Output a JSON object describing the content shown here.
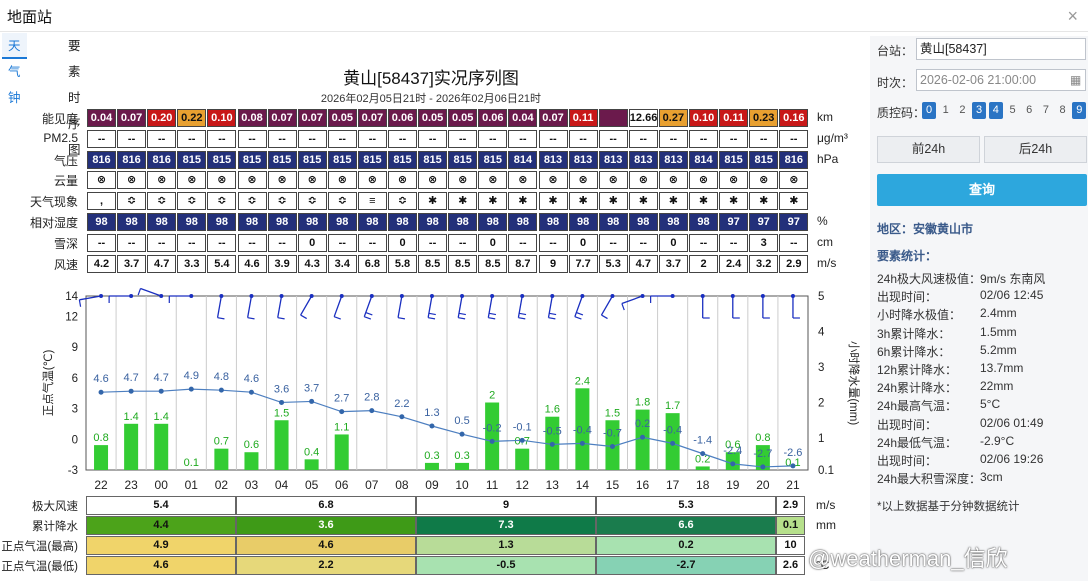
{
  "window": {
    "title": "地面站",
    "close": "×"
  },
  "tabs": [
    {
      "label": "天气钟",
      "active": true
    },
    {
      "label": "要素时序图",
      "active": false
    }
  ],
  "chart": {
    "title": "黄山[58437]实况序列图",
    "subtitle": "2026年02月05日21时 - 2026年02月06日21时"
  },
  "hours": [
    "22",
    "23",
    "00",
    "01",
    "02",
    "03",
    "04",
    "05",
    "06",
    "07",
    "08",
    "09",
    "10",
    "11",
    "12",
    "13",
    "14",
    "15",
    "16",
    "17",
    "18",
    "19",
    "20",
    "21"
  ],
  "rows": [
    {
      "label": "能见度",
      "unit": "km",
      "values": [
        "0.04",
        "0.07",
        "0.20",
        "0.22",
        "0.10",
        "0.08",
        "0.07",
        "0.07",
        "0.05",
        "0.07",
        "0.06",
        "0.05",
        "0.05",
        "0.06",
        "0.04",
        "0.07",
        "0.11",
        "",
        "12.66",
        "0.27",
        "0.10",
        "0.11",
        "0.23",
        "0.16"
      ],
      "colors": [
        "#6b1a4c",
        "#6b1a4c",
        "#c81818",
        "#e8a030",
        "#c81818",
        "#6b1a4c",
        "#6b1a4c",
        "#6b1a4c",
        "#6b1a4c",
        "#6b1a4c",
        "#6b1a4c",
        "#6b1a4c",
        "#6b1a4c",
        "#6b1a4c",
        "#6b1a4c",
        "#6b1a4c",
        "#c81818",
        "#6b1a4c",
        "#ffffff",
        "#e8a030",
        "#c81818",
        "#c81818",
        "#e8a030",
        "#c81818"
      ]
    },
    {
      "label": "PM2.5",
      "unit": "μg/m³",
      "values": [
        "--",
        "--",
        "--",
        "--",
        "--",
        "--",
        "--",
        "--",
        "--",
        "--",
        "--",
        "--",
        "--",
        "--",
        "--",
        "--",
        "--",
        "--",
        "--",
        "--",
        "--",
        "--",
        "--",
        "--"
      ]
    },
    {
      "label": "气压",
      "unit": "hPa",
      "values": [
        "816",
        "816",
        "816",
        "815",
        "815",
        "815",
        "815",
        "815",
        "815",
        "815",
        "815",
        "815",
        "815",
        "815",
        "814",
        "813",
        "813",
        "813",
        "813",
        "813",
        "814",
        "815",
        "815",
        "816"
      ],
      "bg": "#23307a"
    },
    {
      "label": "云量",
      "unit": "",
      "values": [
        "⊗",
        "⊗",
        "⊗",
        "⊗",
        "⊗",
        "⊗",
        "⊗",
        "⊗",
        "⊗",
        "⊗",
        "⊗",
        "⊗",
        "⊗",
        "⊗",
        "⊗",
        "⊗",
        "⊗",
        "⊗",
        "⊗",
        "⊗",
        "⊗",
        "⊗",
        "⊗",
        "⊗"
      ]
    },
    {
      "label": "天气现象",
      "unit": "",
      "values": [
        ",",
        "≎",
        "≎",
        "≎",
        "≎",
        "≎",
        "≎",
        "≎",
        "≎",
        "≡",
        "≎",
        "✱",
        "✱",
        "✱",
        "✱",
        "✱",
        "✱",
        "✱",
        "✱",
        "✱",
        "✱",
        "✱",
        "✱",
        "✱"
      ]
    },
    {
      "label": "相对湿度",
      "unit": "%",
      "values": [
        "98",
        "98",
        "98",
        "98",
        "98",
        "98",
        "98",
        "98",
        "98",
        "98",
        "98",
        "98",
        "98",
        "98",
        "98",
        "98",
        "98",
        "98",
        "98",
        "98",
        "98",
        "97",
        "97",
        "97"
      ],
      "bg": "#23307a"
    },
    {
      "label": "雪深",
      "unit": "cm",
      "values": [
        "--",
        "--",
        "--",
        "--",
        "--",
        "--",
        "--",
        "0",
        "--",
        "--",
        "0",
        "--",
        "--",
        "0",
        "--",
        "--",
        "0",
        "--",
        "--",
        "0",
        "--",
        "--",
        "3",
        "--"
      ]
    },
    {
      "label": "风速",
      "unit": "m/s",
      "values": [
        "4.2",
        "3.7",
        "4.7",
        "3.3",
        "5.4",
        "4.6",
        "3.9",
        "4.3",
        "3.4",
        "6.8",
        "5.8",
        "8.5",
        "8.5",
        "8.5",
        "8.7",
        "9",
        "7.7",
        "5.3",
        "4.7",
        "3.7",
        "2",
        "2.4",
        "3.2",
        "2.9"
      ]
    }
  ],
  "chart_data": {
    "type": "bar",
    "categories": [
      "22",
      "23",
      "00",
      "01",
      "02",
      "03",
      "04",
      "05",
      "06",
      "07",
      "08",
      "09",
      "10",
      "11",
      "12",
      "13",
      "14",
      "15",
      "16",
      "17",
      "18",
      "19",
      "20",
      "21"
    ],
    "series": [
      {
        "values": [
          0.8,
          1.4,
          1.4,
          0.1,
          0.7,
          0.6,
          1.5,
          0.4,
          1.1,
          0,
          0,
          0.3,
          0.3,
          2,
          0.7,
          1.6,
          2.4,
          1.5,
          1.8,
          1.7,
          0.2,
          0.6,
          0.8,
          0.1
        ]
      },
      {
        "values": [
          4.6,
          4.7,
          4.7,
          4.9,
          4.8,
          4.6,
          3.6,
          3.7,
          2.7,
          2.8,
          2.2,
          1.3,
          0.5,
          -0.2,
          -0.1,
          -0.5,
          -0.4,
          -0.7,
          0.2,
          -0.4,
          -1.4,
          -2.4,
          -2.7,
          -2.6
        ]
      }
    ],
    "wind_dirs": [
      280,
      270,
      250,
      270,
      350,
      350,
      350,
      330,
      340,
      340,
      350,
      350,
      350,
      350,
      350,
      350,
      340,
      330,
      290,
      270,
      0,
      0,
      0,
      0
    ],
    "left_axis": {
      "label": "正点气温(℃)",
      "ticks": [
        "14",
        "12",
        "9",
        "6",
        "3",
        "0",
        "-3"
      ],
      "ylim": [
        -3,
        14
      ]
    },
    "right_axis": {
      "label": "小时降水量(mm)",
      "ticks": [
        "5",
        "4",
        "3",
        "2",
        "1",
        "0.1"
      ]
    }
  },
  "bottom": {
    "rows": [
      {
        "label": "极大风速",
        "unit": "m/s",
        "values": [
          "5.4",
          "6.8",
          "9",
          "5.3",
          "2.9"
        ],
        "colors": [
          "#ffffff",
          "#ffffff",
          "#ffffff",
          "#ffffff",
          "#ffffff"
        ]
      },
      {
        "label": "累计降水",
        "unit": "mm",
        "values": [
          "4.4",
          "3.6",
          "7.3",
          "6.6",
          "0.1"
        ],
        "colors": [
          "#4ca31a",
          "#3e9a17",
          "#0f7a48",
          "#1a7c4d",
          "#b6e08c"
        ]
      },
      {
        "label": "正点气温(最高)",
        "unit": "",
        "values": [
          "4.9",
          "4.6",
          "1.3",
          "0.2",
          "10"
        ],
        "colors": [
          "#f0d46a",
          "#e8cc68",
          "#b8dc98",
          "#a8e2b0",
          "#ffffff"
        ]
      },
      {
        "label": "正点气温(最低)",
        "unit": "°C",
        "values": [
          "4.6",
          "2.2",
          "-0.5",
          "-2.7",
          "2.6"
        ],
        "colors": [
          "#f0d46a",
          "#e6d87a",
          "#a8e2b0",
          "#86d2b4",
          "#ffffff"
        ]
      }
    ]
  },
  "side": {
    "station_label": "台站：",
    "station_value": "黄山[58437]",
    "time_label": "时次：",
    "time_value": "2026-02-06 21:00:00",
    "qc_label": "质控码：",
    "qc": [
      "0",
      "1",
      "2",
      "3",
      "4",
      "5",
      "6",
      "7",
      "8",
      "9"
    ],
    "prev_btn": "前24h",
    "next_btn": "后24h",
    "query_btn": "查询",
    "region": "地区：安徽黄山市",
    "stats_title": "要素统计：",
    "stats": [
      {
        "k": "24h极大风速极值：",
        "v": "9m/s 东南风"
      },
      {
        "k": "出现时间：",
        "v": "02/06 12:45"
      },
      {
        "k": "小时降水极值：",
        "v": "2.4mm"
      },
      {
        "k": "3h累计降水：",
        "v": "1.5mm"
      },
      {
        "k": "6h累计降水：",
        "v": "5.2mm"
      },
      {
        "k": "12h累计降水：",
        "v": "13.7mm"
      },
      {
        "k": "24h累计降水：",
        "v": "22mm"
      },
      {
        "k": "24h最高气温：",
        "v": "5°C"
      },
      {
        "k": "出现时间：",
        "v": "02/06 01:49"
      },
      {
        "k": "24h最低气温：",
        "v": "-2.9°C"
      },
      {
        "k": "出现时间：",
        "v": "02/06 19:26"
      },
      {
        "k": "24h最大积雪深度：",
        "v": "3cm"
      }
    ],
    "note": "*以上数据基于分钟数据统计"
  },
  "watermark": "@weatherman_信欣",
  "colors": {
    "accent": "#1a78d6",
    "bar": "#33cc33",
    "line": "#3366aa",
    "barb": "#1a2fc0"
  }
}
